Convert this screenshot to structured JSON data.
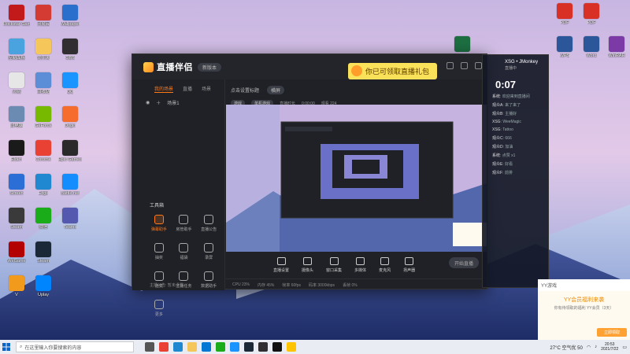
{
  "desktop_icons_left": [
    {
      "label": "Rockstar Games",
      "color": "#c21a1a"
    },
    {
      "label": "控制面板",
      "color": "#4aa3df"
    },
    {
      "label": "火绒",
      "color": "#e6e6e6"
    },
    {
      "label": "此电脑",
      "color": "#6b8bb3"
    },
    {
      "label": "Elden",
      "color": "#1a1a1a"
    },
    {
      "label": "Screen",
      "color": "#2b6fd6"
    },
    {
      "label": "Steam",
      "color": "#3a3a3a"
    },
    {
      "label": "WeGame",
      "color": "#b30000"
    },
    {
      "label": "V",
      "color": "#f29a1c"
    },
    {
      "label": "网易云",
      "color": "#d43c33"
    },
    {
      "label": "文件夹",
      "color": "#f5c65a"
    },
    {
      "label": "回收站",
      "color": "#5b8ed6"
    },
    {
      "label": "GeForce",
      "color": "#76b900"
    },
    {
      "label": "Chrome",
      "color": "#e94235"
    },
    {
      "label": "Edge",
      "color": "#1f88d1"
    },
    {
      "label": "微信",
      "color": "#1aad19"
    },
    {
      "label": "Steam",
      "color": "#1b2838"
    },
    {
      "label": "Uplay",
      "color": "#0085ff"
    },
    {
      "label": "Wallpaper",
      "color": "#2a6fcc"
    },
    {
      "label": "OBS",
      "color": "#302e31"
    },
    {
      "label": "QQ",
      "color": "#1a94ff"
    },
    {
      "label": "Origin",
      "color": "#f56c2d"
    },
    {
      "label": "Epic Games",
      "color": "#2a2a2a"
    },
    {
      "label": "Battle.net",
      "color": "#148eff"
    },
    {
      "label": "Teams",
      "color": "#5558af"
    }
  ],
  "desktop_icons_right": [
    {
      "label": "PDF",
      "color": "#d93025"
    },
    {
      "label": "PDF",
      "color": "#d93025"
    },
    {
      "label": "WPS",
      "color": "#2b579a"
    },
    {
      "label": "Excel",
      "color": "#1d6f42"
    },
    {
      "label": "Word",
      "color": "#2b579a"
    },
    {
      "label": "WinRAR",
      "color": "#7b3aa6"
    }
  ],
  "app": {
    "title": "直播伴侣",
    "version": "新版本",
    "banner": "你已可领取直播礼包",
    "left_tabs": [
      "我的场景",
      "直播",
      "场景"
    ],
    "scene_name": "场景1",
    "tools_title": "工具箱",
    "tools": [
      {
        "label": "弹幕助手",
        "hot": true
      },
      {
        "label": "房管助手",
        "hot": false
      },
      {
        "label": "直播公告",
        "hot": false
      },
      {
        "label": "抽奖",
        "hot": false
      },
      {
        "label": "福袋",
        "hot": false
      },
      {
        "label": "录屏",
        "hot": false
      },
      {
        "label": "连麦",
        "hot": false
      },
      {
        "label": "主播任务",
        "hot": false
      },
      {
        "label": "数据助手",
        "hot": false
      },
      {
        "label": "更多",
        "hot": false
      }
    ],
    "main_tabs": [
      "点击设置标题",
      "横屏"
    ],
    "main_info": [
      "游戏",
      "单机游戏",
      "直播时长",
      "0:00:00",
      "观看 224"
    ],
    "controls": [
      "直播设置",
      "摄像头",
      "窗口采集",
      "多媒体",
      "麦克风",
      "扬声器"
    ],
    "live_button": "开始直播",
    "status": [
      "CPU 23%",
      "内存 45%",
      "帧率 60fps",
      "码率 3000kbps",
      "丢帧 0%"
    ],
    "left_status": "主播公告: 暂未设置"
  },
  "chat": {
    "header": "XSG • JMonkey",
    "sub": "直播中",
    "timer": "0:07",
    "lines": [
      {
        "user": "系统",
        "text": "欢迎来到直播间"
      },
      {
        "user": "观众A",
        "text": "来了来了"
      },
      {
        "user": "观众B",
        "text": "主播好"
      },
      {
        "user": "XSG",
        "text": "WeeMagic"
      },
      {
        "user": "XSG",
        "text": "Tattoo"
      },
      {
        "user": "观众C",
        "text": "666"
      },
      {
        "user": "观众D",
        "text": "加油"
      },
      {
        "user": "系统",
        "text": "点赞 x1"
      },
      {
        "user": "观众E",
        "text": "好看"
      },
      {
        "user": "观众F",
        "text": "前排"
      }
    ]
  },
  "yy_popup": {
    "header": "YY游戏",
    "title": "YY会员福利来袭",
    "body": "你有待领取的福利 YY会员（3天）",
    "button": "立即领取"
  },
  "taskbar": {
    "search_placeholder": "在这里输入你要搜索的内容",
    "weather": "27°C 空气优 50",
    "time": "20:53",
    "date": "2021/7/22",
    "icons": [
      {
        "name": "task-view",
        "color": "#555"
      },
      {
        "name": "chrome",
        "color": "#e94235"
      },
      {
        "name": "edge",
        "color": "#1f88d1"
      },
      {
        "name": "explorer",
        "color": "#f5c65a"
      },
      {
        "name": "store",
        "color": "#0078d4"
      },
      {
        "name": "wechat",
        "color": "#1aad19"
      },
      {
        "name": "qq",
        "color": "#1a94ff"
      },
      {
        "name": "steam",
        "color": "#1b2838"
      },
      {
        "name": "obs",
        "color": "#302e31"
      },
      {
        "name": "douyin",
        "color": "#111"
      },
      {
        "name": "yy",
        "color": "#ffc400"
      }
    ]
  }
}
